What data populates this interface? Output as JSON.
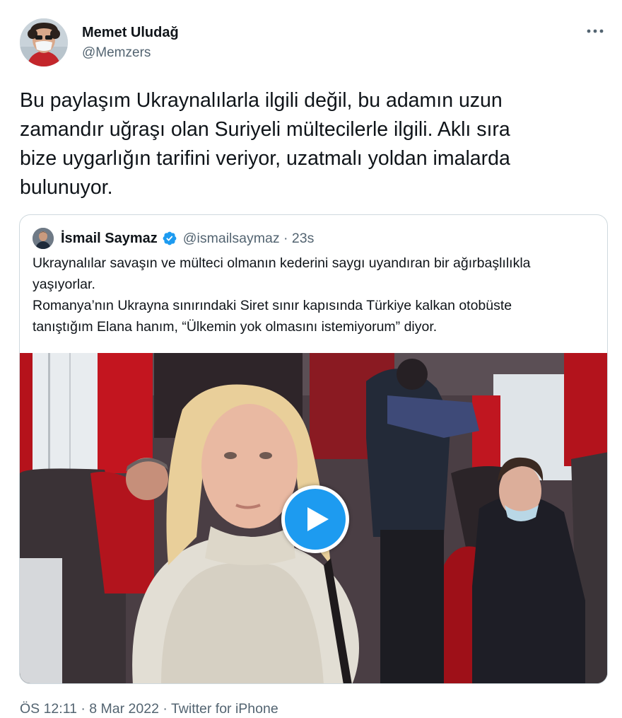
{
  "author": {
    "name": "Memet Uludağ",
    "handle": "@Memzers"
  },
  "tweet": {
    "lines": [
      "Bu paylaşım Ukraynalılarla ilgili değil, bu adamın uzun",
      "zamandır uğraşı olan Suriyeli mültecilerle ilgili. Aklı sıra",
      "bize uygarlığın tarifini veriyor, uzatmalı yoldan imalarda",
      "bulunuyor."
    ]
  },
  "quote": {
    "name": "İsmail Saymaz",
    "meta": "@ismailsaymaz · 23s",
    "lines": [
      "Ukraynalılar savaşın ve mülteci olmanın kederini saygı uyandıran bir ağırbaşlılıkla",
      "yaşıyorlar.",
      "Romanya’nın Ukrayna sınırındaki Siret sınır kapısında Türkiye kalkan otobüste",
      "tanıştığım Elana hanım, “Ülkemin yok olmasını istemiyorum” diyor."
    ]
  },
  "icons": {
    "more": "more-horizontal-icon",
    "verified": "verified-badge-icon",
    "play": "play-icon"
  },
  "colors": {
    "accent": "#1d9bf0",
    "secondary_text": "#536471",
    "border": "#cfd9de"
  },
  "footer": {
    "time": "ÖS 12:11",
    "date": "8 Mar 2022",
    "source": "Twitter for iPhone",
    "separator": "·"
  }
}
